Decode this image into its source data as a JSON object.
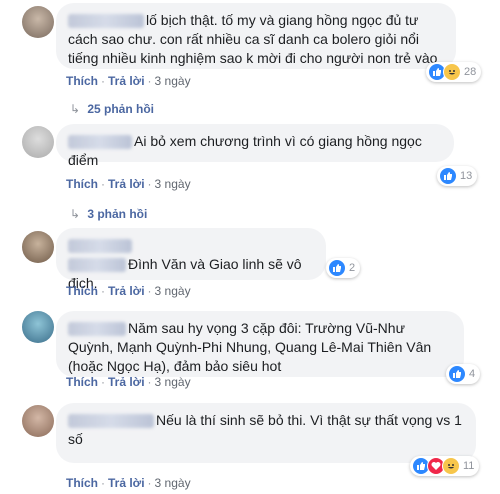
{
  "comments": [
    {
      "text": "lố bịch thật. tố my và giang hồng ngọc đủ tư cách sao chư. con rất nhiều ca sĩ danh ca bolero giỏi nổi tiếng nhiều kinh nghiệm sao k mời đi cho người non trẻ vào",
      "like": "Thích",
      "reply": "Trả lời",
      "time": "3 ngày",
      "reactions": [
        "like",
        "haha"
      ],
      "count": "28",
      "replies": "25 phản hồi"
    },
    {
      "text": "Ai bỏ xem chương trình vì có giang hồng ngọc điểm",
      "like": "Thích",
      "reply": "Trả lời",
      "time": "3 ngày",
      "reactions": [
        "like"
      ],
      "count": "13",
      "replies": "3 phản hồi"
    },
    {
      "text": "Đình Văn và Giao linh sẽ vô địch.",
      "like": "Thích",
      "reply": "Trả lời",
      "time": "3 ngày",
      "reactions": [
        "like"
      ],
      "count": "2"
    },
    {
      "text": "Năm sau hy vọng 3 cặp đôi: Trường Vũ-Như Quỳnh, Mạnh Quỳnh-Phi Nhung, Quang Lê-Mai Thiên Vân (hoặc Ngọc Hạ), đảm bảo siêu hot",
      "like": "Thích",
      "reply": "Trả lời",
      "time": "3 ngày",
      "reactions": [
        "like"
      ],
      "count": "4"
    },
    {
      "text": "Nếu là thí sinh sẽ bỏ thi. Vì thật sự thất vọng vs 1 số",
      "like": "Thích",
      "reply": "Trả lời",
      "time": "3 ngày",
      "reactions": [
        "like",
        "love",
        "haha"
      ],
      "count": "11"
    }
  ],
  "colors": {
    "link": "#4b67a1",
    "like": "#2d88ff",
    "love": "#f0284a",
    "haha": "#f7c64b"
  }
}
